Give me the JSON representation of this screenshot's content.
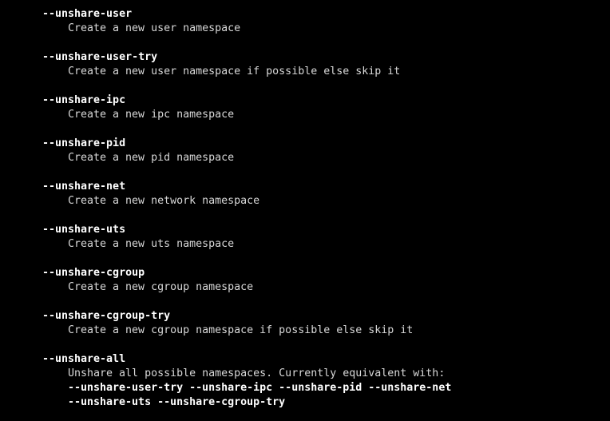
{
  "colors": {
    "background": "#000000",
    "text": "#d8d8d8",
    "option": "#ffffff"
  },
  "options": [
    {
      "name": "--unshare-user",
      "desc": "Create a new user namespace"
    },
    {
      "name": "--unshare-user-try",
      "desc": "Create a new user namespace if possible else skip it"
    },
    {
      "name": "--unshare-ipc",
      "desc": "Create a new ipc namespace"
    },
    {
      "name": "--unshare-pid",
      "desc": "Create a new pid namespace"
    },
    {
      "name": "--unshare-net",
      "desc": "Create a new network namespace"
    },
    {
      "name": "--unshare-uts",
      "desc": "Create a new uts namespace"
    },
    {
      "name": "--unshare-cgroup",
      "desc": "Create a new cgroup namespace"
    },
    {
      "name": "--unshare-cgroup-try",
      "desc": "Create a new cgroup namespace if possible else skip it"
    },
    {
      "name": "--unshare-all",
      "desc": "Unshare all possible namespaces. Currently equivalent with:"
    }
  ],
  "equivalent_line_1": "--unshare-user-try --unshare-ipc --unshare-pid --unshare-net",
  "equivalent_line_2": "--unshare-uts --unshare-cgroup-try"
}
